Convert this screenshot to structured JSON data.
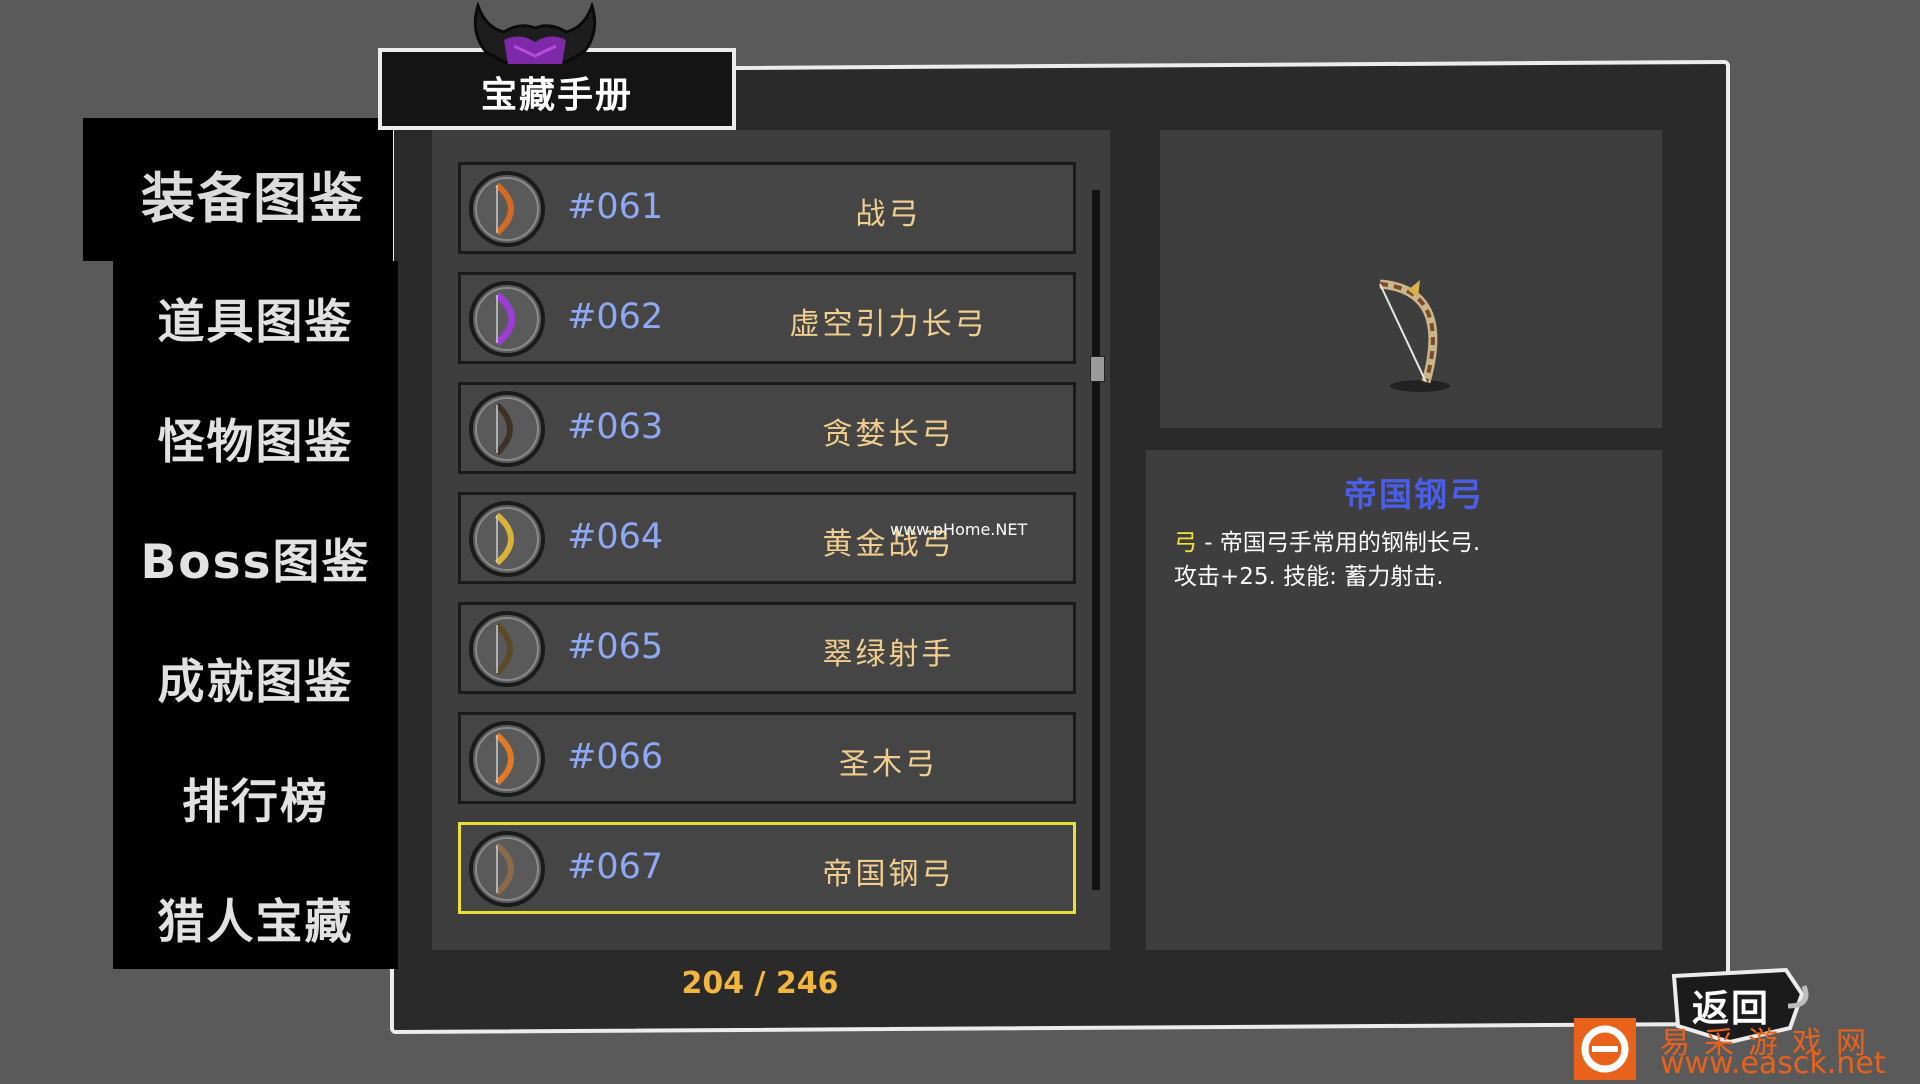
{
  "title": "宝藏手册",
  "sidebar": {
    "items": [
      {
        "label": "装备图鉴",
        "active": true
      },
      {
        "label": "道具图鉴"
      },
      {
        "label": "怪物图鉴"
      },
      {
        "label": "Boss图鉴"
      },
      {
        "label": "成就图鉴"
      },
      {
        "label": "排行榜"
      },
      {
        "label": "猎人宝藏"
      }
    ]
  },
  "list": {
    "items": [
      {
        "id": "#061",
        "name": "战弓",
        "icon": "orange-bow-icon"
      },
      {
        "id": "#062",
        "name": "虚空引力长弓",
        "icon": "purple-bow-icon"
      },
      {
        "id": "#063",
        "name": "贪婪长弓",
        "icon": "dark-bow-icon"
      },
      {
        "id": "#064",
        "name": "黄金战弓",
        "icon": "golden-bow-icon"
      },
      {
        "id": "#065",
        "name": "翠绿射手",
        "icon": "green-bow-icon"
      },
      {
        "id": "#066",
        "name": "圣木弓",
        "icon": "orange-bow-icon"
      },
      {
        "id": "#067",
        "name": "帝国钢弓",
        "icon": "steel-bow-icon",
        "selected": true
      }
    ],
    "count": "204 / 246"
  },
  "detail": {
    "name": "帝国钢弓",
    "type_keyword": "弓",
    "description_1": " - 帝国弓手常用的钢制长弓.",
    "description_2": "攻击+25. 技能: 蓄力射击.",
    "image_icon": "steel-bow-icon"
  },
  "back_button": {
    "label": "返回"
  },
  "watermark": "www.pHome.NET",
  "site_branding": {
    "name": "易采游戏网",
    "url": "www.easck.net"
  },
  "colors": {
    "selected_border": "#e9e13a",
    "item_id": "#8fa8f2",
    "item_name": "#f0ce8e",
    "detail_name": "#4a5fe6",
    "count": "#f0b640"
  }
}
